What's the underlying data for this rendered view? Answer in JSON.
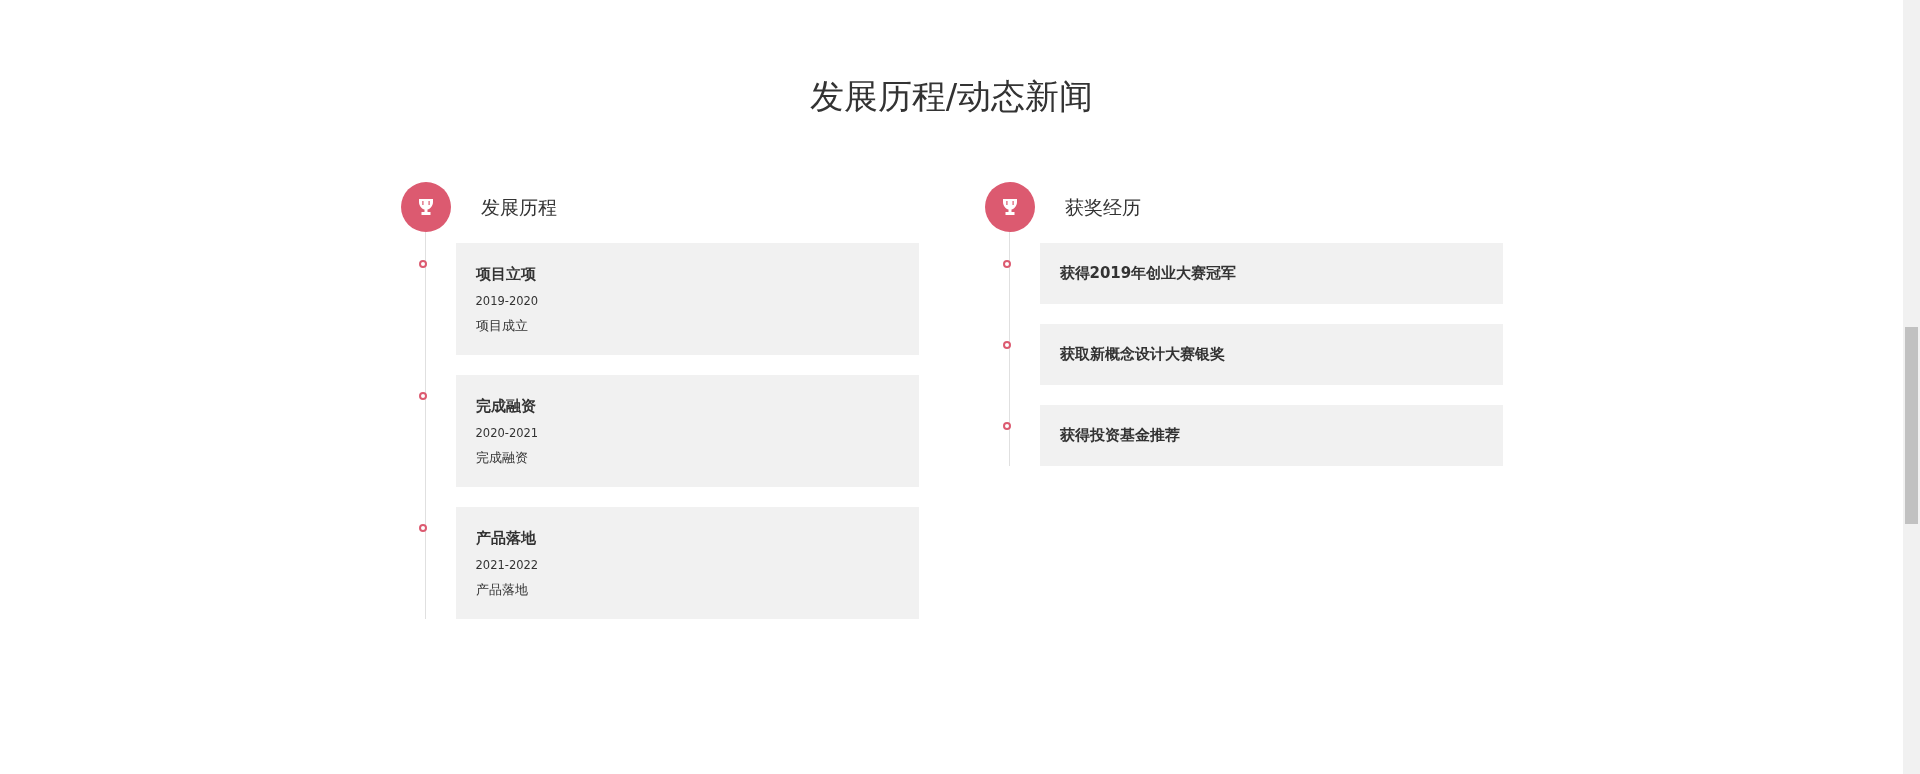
{
  "title": "发展历程/动态新闻",
  "sections": [
    {
      "heading": "发展历程",
      "items": [
        {
          "title": "项目立项",
          "date": "2019-2020",
          "description": "项目成立"
        },
        {
          "title": "完成融资",
          "date": "2020-2021",
          "description": "完成融资"
        },
        {
          "title": "产品落地",
          "date": "2021-2022",
          "description": "产品落地"
        }
      ]
    },
    {
      "heading": "获奖经历",
      "items": [
        {
          "title": "获得2019年创业大赛冠军"
        },
        {
          "title": "获取新概念设计大赛银奖"
        },
        {
          "title": "获得投资基金推荐"
        }
      ]
    }
  ]
}
